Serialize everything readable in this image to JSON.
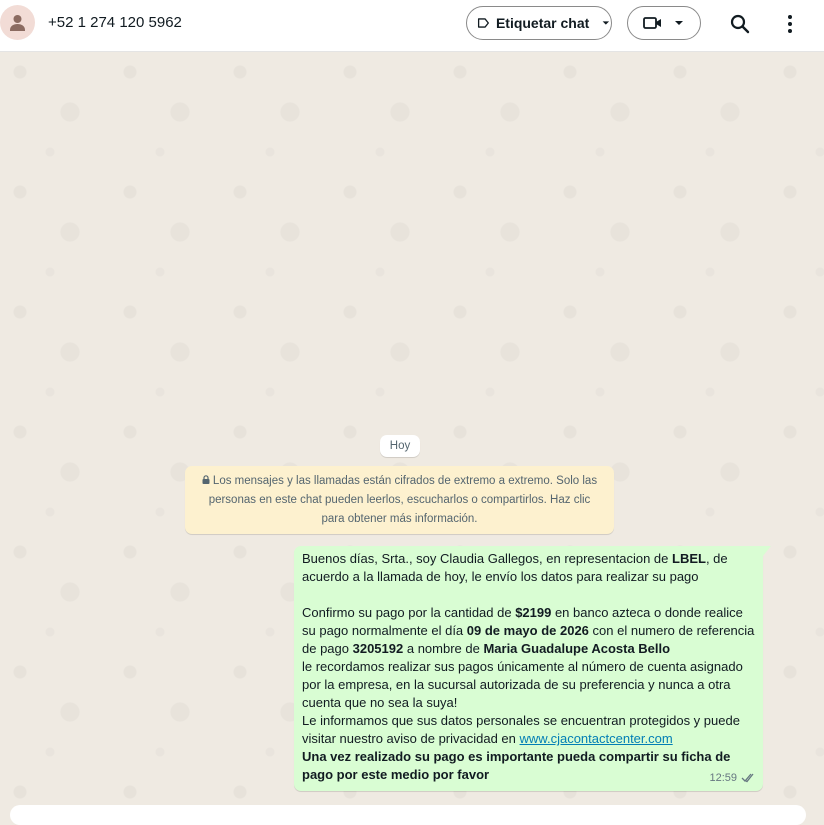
{
  "header": {
    "contact_name": "+52 1 274 120 5962",
    "label_button": "Etiquetar chat",
    "icons": [
      "person-icon",
      "label-tag-icon",
      "chevron-down-icon",
      "video-camera-icon",
      "search-icon",
      "more-vertical-icon"
    ]
  },
  "chat": {
    "date_chip": "Hoy",
    "encryption_notice": "Los mensajes y las llamadas están cifrados de extremo a extremo. Solo las personas en este chat pueden leerlos, escucharlos o compartirlos. Haz clic para obtener más información.",
    "message": {
      "p1_a": "Buenos días, Srta.,  soy Claudia Gallegos, en representacion de ",
      "p1_b": "LBEL",
      "p1_c": ",  de acuerdo a la llamada de hoy, le envío los datos para realizar su pago",
      "p2_a": " Confirmo su pago por la cantidad de ",
      "p2_amount": "$2199",
      "p2_b": "  en banco azteca o donde realice su pago normalmente el día ",
      "p2_date": "09 de mayo de 2026",
      "p2_c": " con el numero de referencia de pago ",
      "p2_ref": "3205192",
      "p2_d": " a nombre de ",
      "p2_name": "Maria Guadalupe Acosta Bello",
      "p3": " le recordamos realizar sus pagos únicamente al número de cuenta asignado por la empresa, en la sucursal autorizada de su preferencia y nunca a otra cuenta que no sea la suya!",
      "p4": " Le informamos que sus datos personales se encuentran protegidos y puede visitar nuestro aviso de privacidad en ",
      "link": "www.cjacontactcenter.com",
      "p5": "Una vez realizado su pago es importante pueda compartir su ficha de pago por este medio por favor",
      "time": "12:59"
    }
  },
  "colors": {
    "bubble_out": "#d9fdd3",
    "encryption_bg": "#fdf1cf",
    "chat_bg": "#efeae2",
    "link": "#027eb5"
  }
}
